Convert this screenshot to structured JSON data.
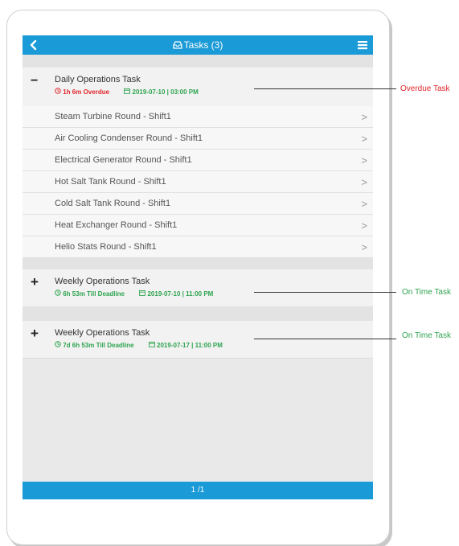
{
  "header": {
    "title": "Tasks (3)"
  },
  "groups": [
    {
      "toggle": "−",
      "title": "Daily Operations Task",
      "status": "1h 6m Overdue",
      "deadline": "2019-07-10 | 03:00 PM",
      "status_color": "#e0262b",
      "deadline_color": "#2ea44f",
      "tasks": [
        "Steam Turbine Round - Shift1",
        "Air Cooling Condenser Round - Shift1",
        "Electrical Generator Round - Shift1",
        "Hot Salt Tank Round - Shift1",
        "Cold Salt Tank Round - Shift1",
        "Heat Exchanger Round - Shift1",
        "Helio Stats Round - Shift1"
      ]
    },
    {
      "toggle": "+",
      "title": "Weekly Operations Task",
      "status": "6h 53m Till Deadline",
      "deadline": "2019-07-10 | 11:00 PM",
      "status_color": "#2ea44f",
      "deadline_color": "#2ea44f"
    },
    {
      "toggle": "+",
      "title": "Weekly Operations Task",
      "status": "7d 6h 53m Till Deadline",
      "deadline": "2019-07-17 | 11:00 PM",
      "status_color": "#2ea44f",
      "deadline_color": "#2ea44f"
    }
  ],
  "pager": "1 /1",
  "annotations": {
    "overdue": "Overdue Task",
    "ontime_1": "On Time Task",
    "ontime_2": "On Time Task"
  },
  "colors": {
    "accent": "#1a9ad6",
    "overdue": "#e0262b",
    "ontime": "#2ea44f"
  }
}
